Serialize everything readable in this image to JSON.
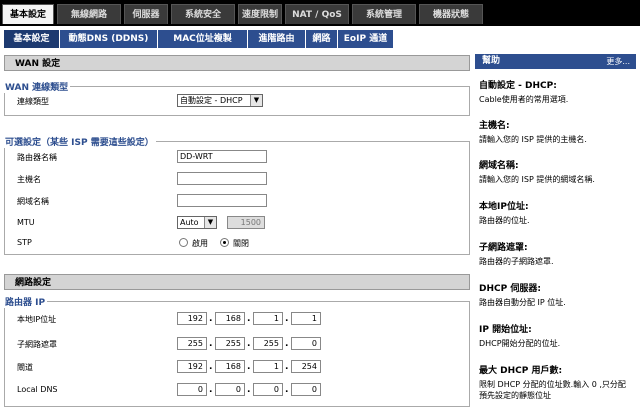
{
  "top_tabs": [
    "基本設定",
    "無線網路",
    "伺服器",
    "系統安全",
    "速度限制",
    "NAT / QoS",
    "系統管理",
    "機器狀態"
  ],
  "sub_tabs": [
    "基本設定",
    "動態DNS (DDNS)",
    "MAC位址複製",
    "進階路由",
    "網路",
    "EoIP 通道"
  ],
  "wan": {
    "section_title": "WAN 設定",
    "legend": "WAN 連線類型",
    "conn_label": "連線類型",
    "conn_value": "自動設定 - DHCP"
  },
  "optional": {
    "legend": "可選設定（某些 ISP 需要這些設定）",
    "router_name_label": "路由器名稱",
    "router_name_value": "DD-WRT",
    "hostname_label": "主機名",
    "domain_label": "網域名稱",
    "mtu_label": "MTU",
    "mtu_mode": "Auto",
    "mtu_value": "1500",
    "stp_label": "STP",
    "stp_enable": "啟用",
    "stp_disable": "關閉"
  },
  "network": {
    "section_title": "網路設定",
    "legend": "路由器 IP",
    "local_ip_label": "本地IP位址",
    "local_ip": [
      "192",
      "168",
      "1",
      "1"
    ],
    "mask_label": "子網路遮罩",
    "mask": [
      "255",
      "255",
      "255",
      "0"
    ],
    "gateway_label": "閘道",
    "gateway": [
      "192",
      "168",
      "1",
      "254"
    ],
    "dns_label": "Local DNS",
    "dns": [
      "0",
      "0",
      "0",
      "0"
    ]
  },
  "help": {
    "title": "幫助",
    "more": "更多...",
    "items": [
      {
        "title": "自動設定 - DHCP:",
        "text": "Cable使用者的常用選項."
      },
      {
        "title": "主機名:",
        "text": "請輸入您的 ISP 提供的主機名."
      },
      {
        "title": "網域名稱:",
        "text": "請輸入您的 ISP 提供的網域名稱."
      },
      {
        "title": "本地IP位址:",
        "text": "路由器的位址."
      },
      {
        "title": "子網路遮罩:",
        "text": "路由器的子網路遮罩."
      },
      {
        "title": "DHCP 伺服器:",
        "text": "路由器自動分配 IP 位址."
      },
      {
        "title": "IP 開始位址:",
        "text": "DHCP開始分配的位址."
      },
      {
        "title": "最大 DHCP 用戶數:",
        "text": "限制 DHCP 分配的位址數.輸入 0 ,只分配預先設定的靜態位址"
      }
    ]
  }
}
